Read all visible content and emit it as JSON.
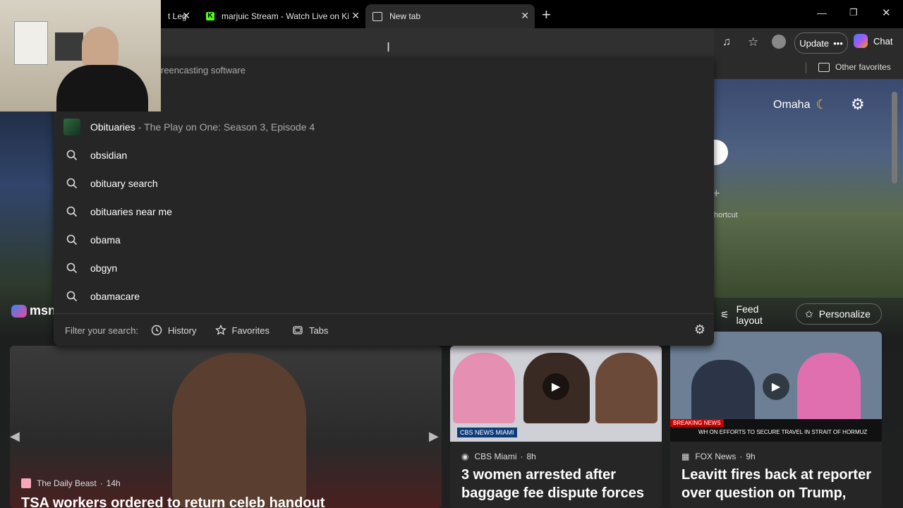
{
  "tabs": [
    {
      "label": "t Leg",
      "icon": "tab-favicon"
    },
    {
      "label": "marjuic Stream - Watch Live on Ki",
      "icon": "kick-icon"
    },
    {
      "label": "New tab",
      "icon": "newtab-icon"
    }
  ],
  "toolbar": {
    "update_label": "Update",
    "chat_label": "Chat"
  },
  "favorites": {
    "other_label": "Other favorites"
  },
  "omnibox": {
    "prior_text": "reencasting software"
  },
  "suggestions": [
    {
      "text": "Obituaries",
      "detail": "- The Play on One: Season 3, Episode 4",
      "icon": "media-thumbnail"
    },
    {
      "text": "obsidian",
      "icon": "search-icon"
    },
    {
      "text": "obituary search",
      "icon": "search-icon"
    },
    {
      "text": "obituaries near me",
      "icon": "search-icon"
    },
    {
      "text": "obama",
      "icon": "search-icon"
    },
    {
      "text": "obgyn",
      "icon": "search-icon"
    },
    {
      "text": "obamacare",
      "icon": "search-icon"
    }
  ],
  "filter": {
    "label": "Filter your search:",
    "history": "History",
    "favorites": "Favorites",
    "tabs": "Tabs"
  },
  "weather": {
    "city": "Omaha",
    "icon": "moon-icon"
  },
  "shortcut": {
    "label": "hortcut"
  },
  "msn": {
    "label": "msn"
  },
  "feed": {
    "layout_label": "Feed layout",
    "personalize_label": "Personalize"
  },
  "cards": [
    {
      "source": "The Daily Beast",
      "age": "14h",
      "headline": "TSA workers ordered to return celeb handout"
    },
    {
      "source": "CBS Miami",
      "age": "8h",
      "headline": "3 women arrested after baggage fee dispute forces"
    },
    {
      "source": "FOX News",
      "age": "9h",
      "headline": "Leavitt fires back at reporter over question on Trump,"
    }
  ],
  "card_captions": {
    "cbs_logo": "CBS NEWS MIAMI",
    "fox_breaking": "BREAKING NEWS",
    "fox_ticker": "WH ON EFFORTS TO SECURE TRAVEL IN STRAIT OF HORMUZ"
  },
  "colors": {
    "titlebar": "#000000",
    "toolbar": "#2b2b2b",
    "popup": "#262626"
  }
}
